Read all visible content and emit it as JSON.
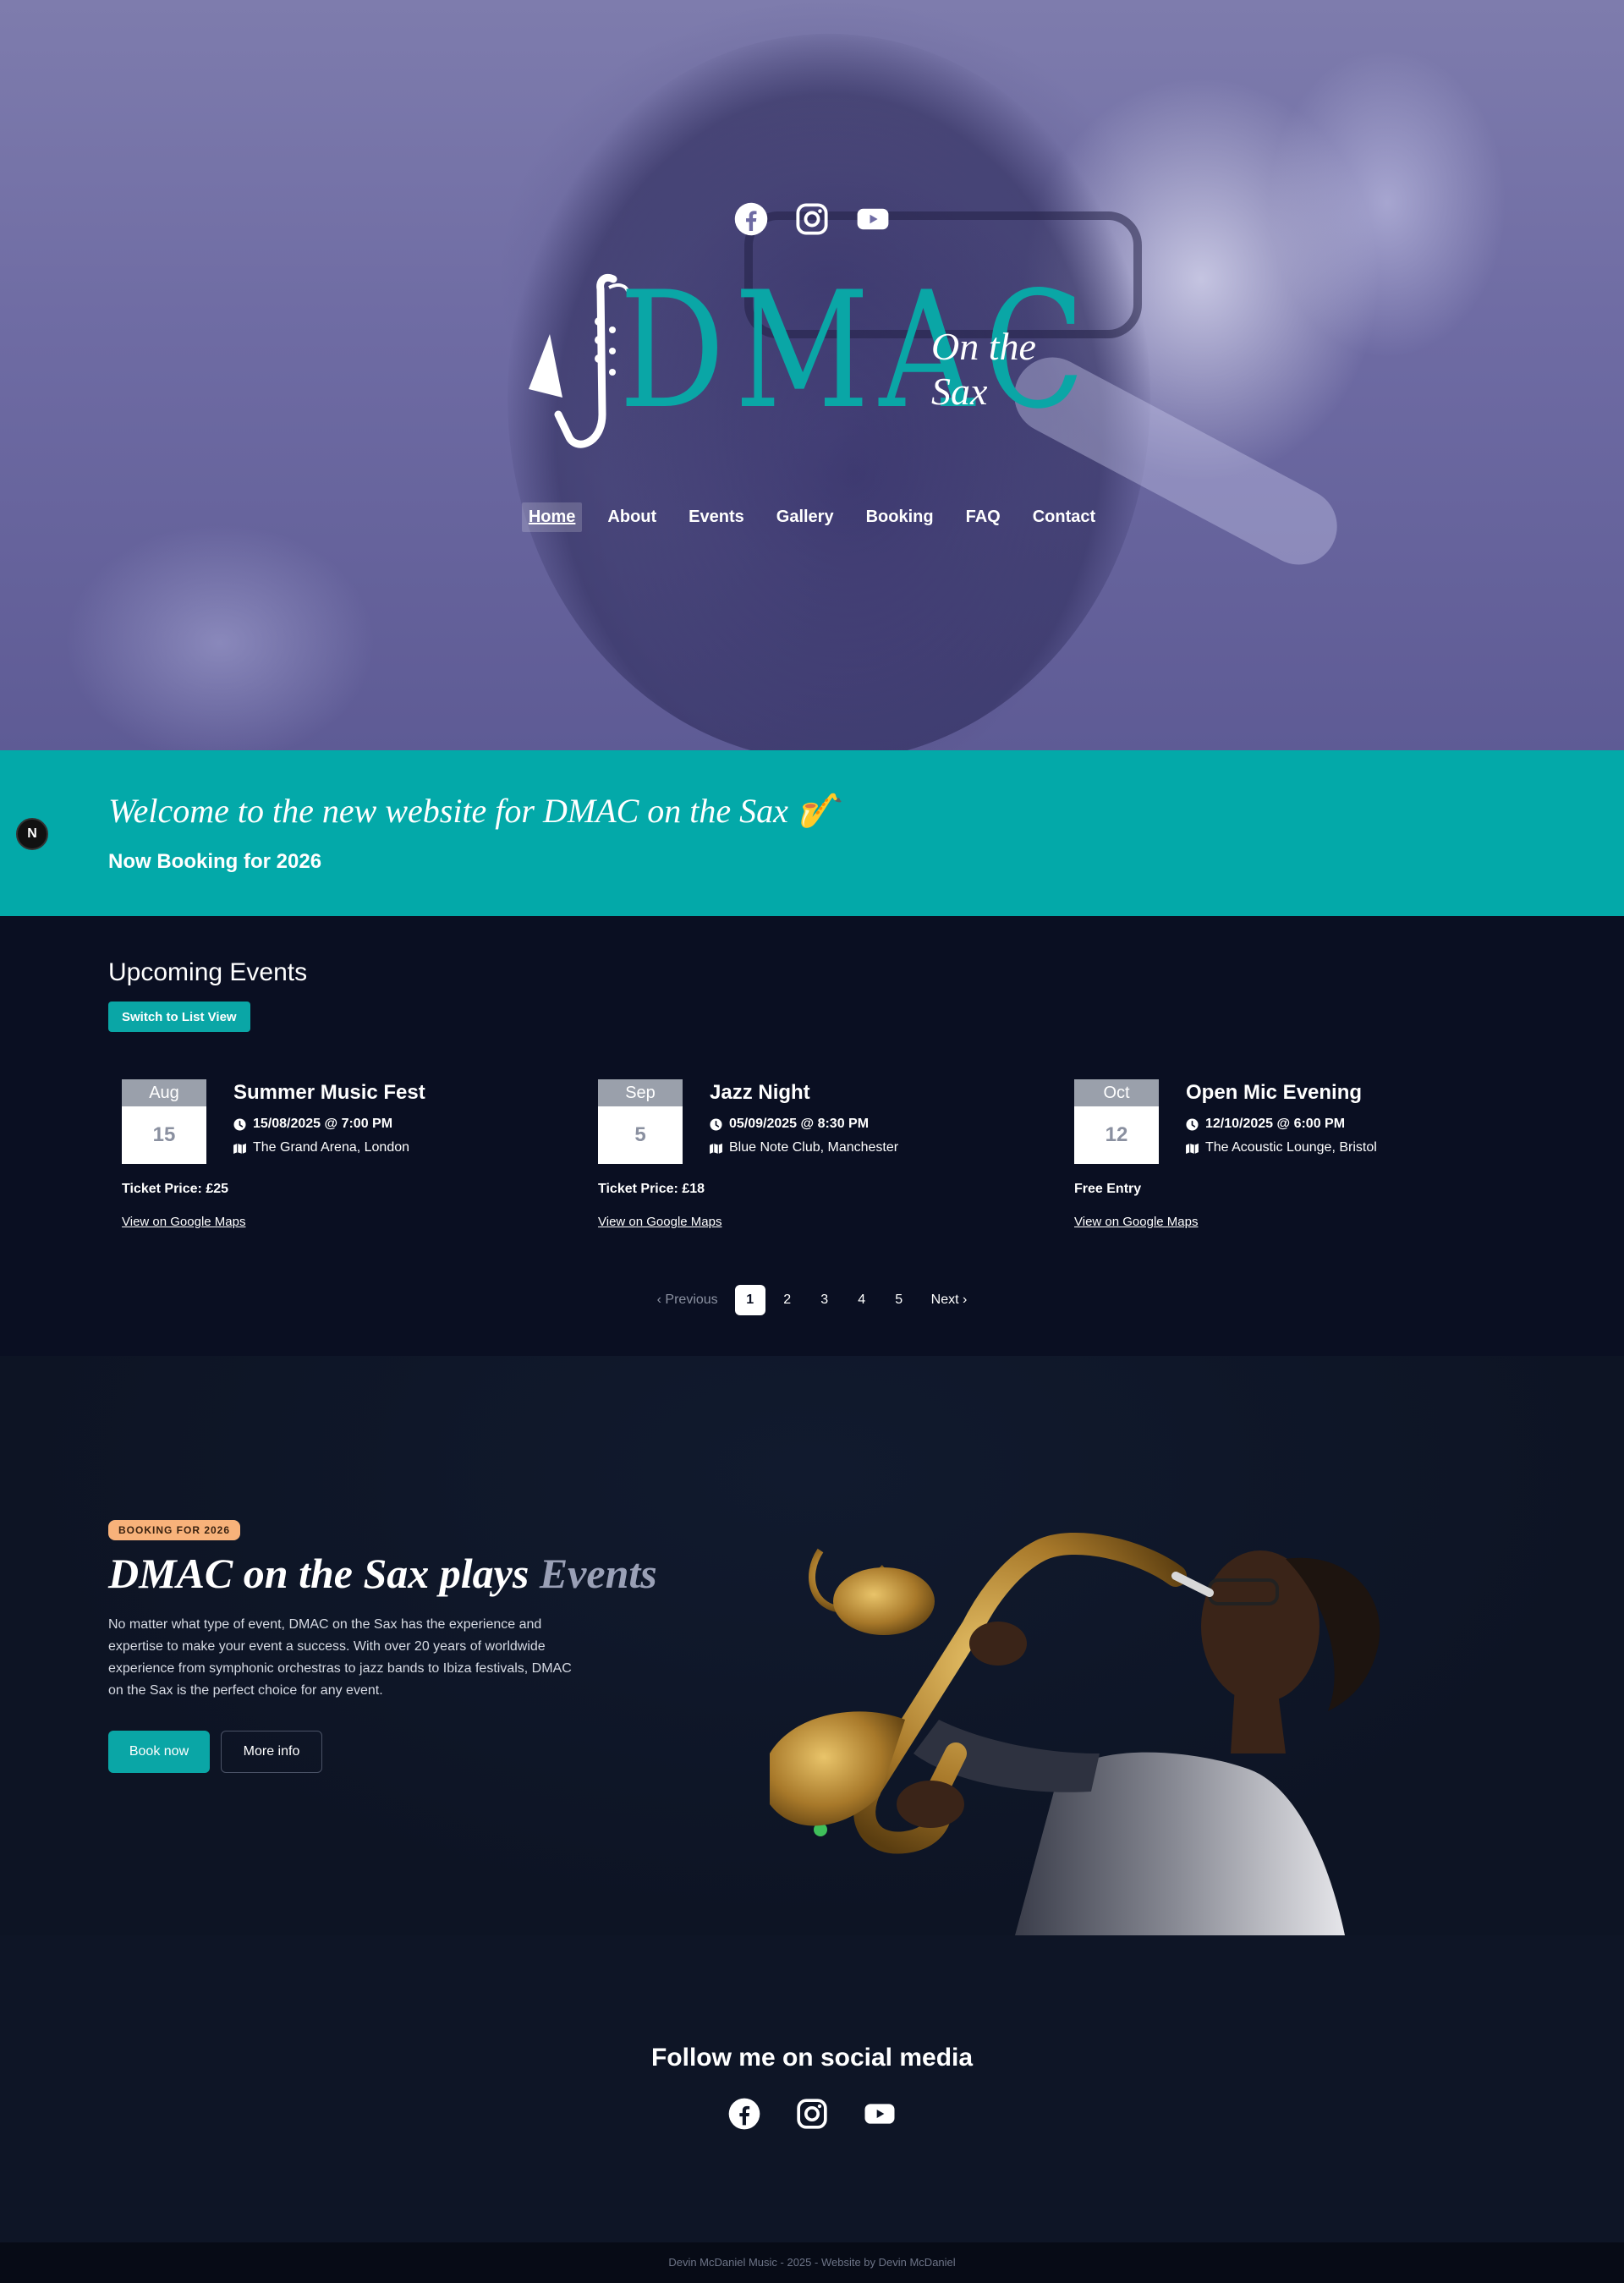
{
  "hero": {
    "social_icons": [
      "facebook-icon",
      "instagram-icon",
      "youtube-icon"
    ],
    "logo": {
      "main": "DMAC",
      "tagline": "On the Sax"
    },
    "nav": [
      {
        "label": "Home",
        "active": true
      },
      {
        "label": "About"
      },
      {
        "label": "Events"
      },
      {
        "label": "Gallery"
      },
      {
        "label": "Booking"
      },
      {
        "label": "FAQ"
      },
      {
        "label": "Contact"
      }
    ]
  },
  "welcome": {
    "title": "Welcome to the new website for DMAC on the Sax 🎷",
    "subtitle": "Now Booking for 2026",
    "badge": "N"
  },
  "events": {
    "heading": "Upcoming Events",
    "switch_label": "Switch to List View",
    "items": [
      {
        "month": "Aug",
        "day": "15",
        "title": "Summer Music Fest",
        "time": "15/08/2025 @ 7:00 PM",
        "location": "The Grand Arena, London",
        "price": "Ticket Price: £25",
        "map": "View on Google Maps"
      },
      {
        "month": "Sep",
        "day": "5",
        "title": "Jazz Night",
        "time": "05/09/2025 @ 8:30 PM",
        "location": "Blue Note Club, Manchester",
        "price": "Ticket Price: £18",
        "map": "View on Google Maps"
      },
      {
        "month": "Oct",
        "day": "12",
        "title": "Open Mic Evening",
        "time": "12/10/2025 @ 6:00 PM",
        "location": "The Acoustic Lounge, Bristol",
        "price": "Free Entry",
        "map": "View on Google Maps"
      }
    ],
    "pager": {
      "previous": "Previous",
      "pages": [
        "1",
        "2",
        "3",
        "4",
        "5"
      ],
      "current": "1",
      "next": "Next"
    }
  },
  "promo": {
    "badge": "BOOKING FOR 2026",
    "title_main": "DMAC on the Sax plays",
    "title_accent": "Events",
    "body": "No matter what type of event, DMAC on the Sax has the experience and expertise to make your event a success. With over 20 years of worldwide experience from symphonic orchestras to jazz bands to Ibiza festivals, DMAC on the Sax is the perfect choice for any event.",
    "book_label": "Book now",
    "more_label": "More info"
  },
  "follow": {
    "heading": "Follow me on social media",
    "icons": [
      "facebook-icon",
      "instagram-icon",
      "youtube-icon"
    ]
  },
  "footer": {
    "text": "Devin McDaniel Music - 2025 - Website by Devin McDaniel"
  },
  "colors": {
    "teal": "#03a9a9",
    "navy": "#0a0f22",
    "badge": "#f8b27a"
  }
}
